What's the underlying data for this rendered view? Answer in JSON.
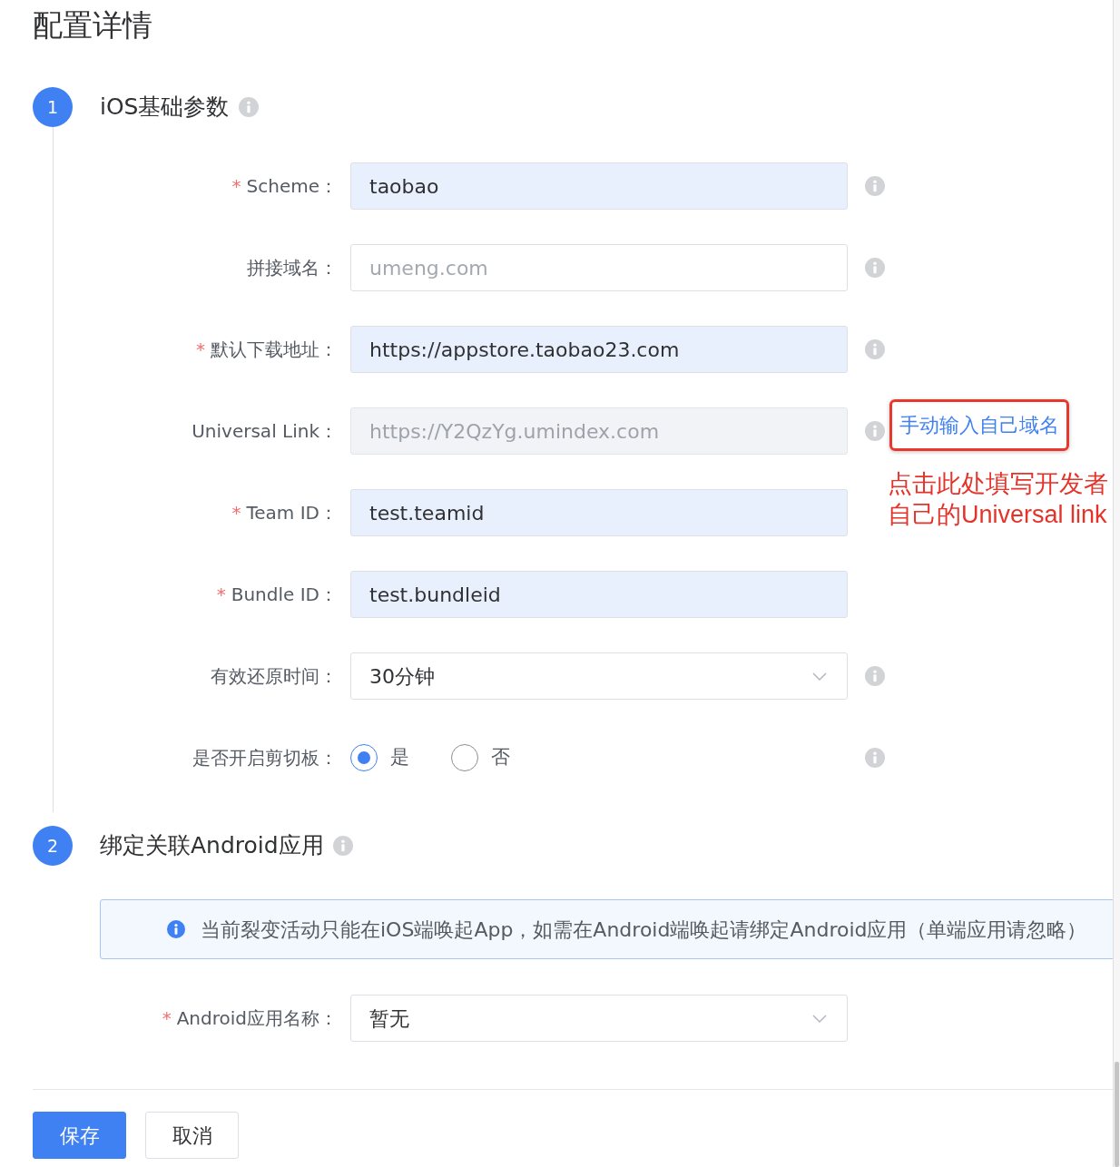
{
  "page": {
    "title": "配置详情"
  },
  "steps": [
    {
      "number": "1",
      "title": "iOS基础参数",
      "info": true,
      "fields": [
        {
          "kind": "input",
          "required_mark": "*",
          "label": "Scheme：",
          "value": "taobao",
          "autofilled": true,
          "disabled": false,
          "info": true
        },
        {
          "kind": "input",
          "label": "拼接域名：",
          "placeholder": "umeng.com",
          "autofilled": false,
          "disabled": false,
          "info": true
        },
        {
          "kind": "input",
          "required_mark": "*",
          "label": "默认下载地址：",
          "value": "https://appstore.taobao23.com",
          "autofilled": true,
          "disabled": false,
          "info": true
        },
        {
          "kind": "input",
          "label": "Universal Link：",
          "placeholder": "https://Y2QzYg.umindex.com",
          "autofilled": false,
          "disabled": true,
          "info": true,
          "link": {
            "text": "手动输入自己域名",
            "highlighted": true
          },
          "annotation": [
            "点击此处填写开发者",
            "自己的Universal link"
          ]
        },
        {
          "kind": "input",
          "required_mark": "*",
          "label": "Team ID：",
          "value": "test.teamid",
          "autofilled": true,
          "disabled": false,
          "info": false
        },
        {
          "kind": "input",
          "required_mark": "*",
          "label": "Bundle ID：",
          "value": "test.bundleid",
          "autofilled": true,
          "disabled": false,
          "info": false
        },
        {
          "kind": "select",
          "label": "有效还原时间：",
          "value": "30分钟",
          "info": true
        },
        {
          "kind": "radio",
          "label": "是否开启剪切板：",
          "options": [
            {
              "label": "是",
              "selected": true
            },
            {
              "label": "否",
              "selected": false
            }
          ],
          "info": true
        }
      ]
    },
    {
      "number": "2",
      "title": "绑定关联Android应用",
      "info": true,
      "notice": "当前裂变活动只能在iOS端唤起App，如需在Android端唤起请绑定Android应用（单端应用请忽略）",
      "fields": [
        {
          "kind": "select",
          "required_mark": "*",
          "label": "Android应用名称：",
          "value": "暂无",
          "info": false
        }
      ]
    }
  ],
  "buttons": [
    {
      "label": "保存",
      "kind": "primary"
    },
    {
      "label": "取消",
      "kind": "default"
    }
  ]
}
